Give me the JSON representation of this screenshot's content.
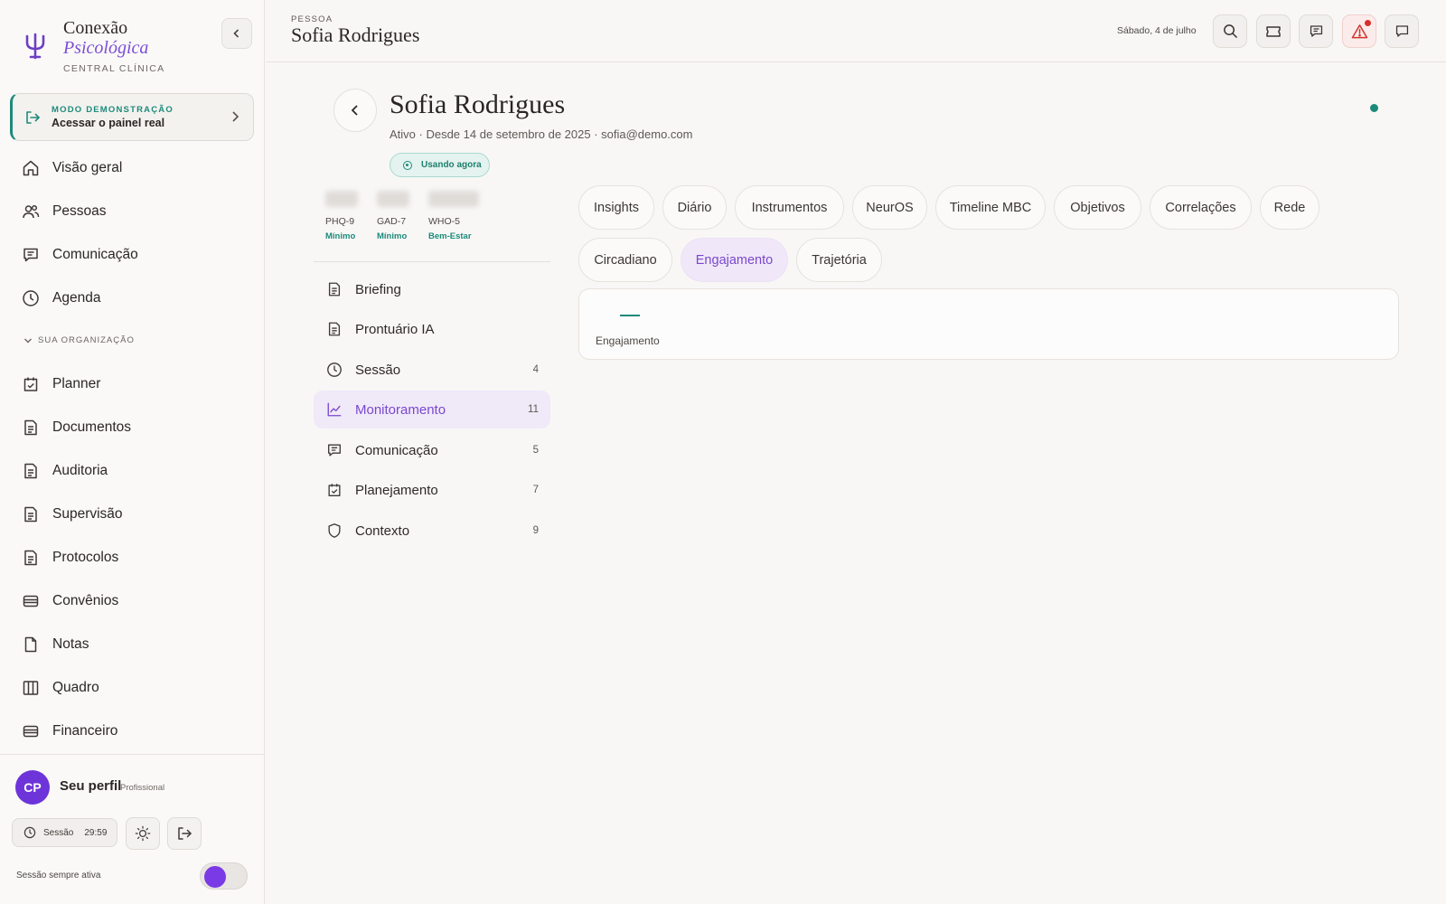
{
  "brand": {
    "line1": "Conexão",
    "line2": "Psicológica",
    "sub": "CENTRAL CLÍNICA"
  },
  "demo": {
    "kicker": "MODO DEMONSTRAÇÃO",
    "title": "Acessar o painel real"
  },
  "nav_main": [
    {
      "label": "Visão geral",
      "icon": "home-icon"
    },
    {
      "label": "Pessoas",
      "icon": "people-icon"
    },
    {
      "label": "Comunicação",
      "icon": "chat-icon"
    },
    {
      "label": "Agenda",
      "icon": "clock-icon"
    }
  ],
  "org_label": "SUA ORGANIZAÇÃO",
  "nav_org": [
    {
      "label": "Planner",
      "icon": "calendar-check-icon"
    },
    {
      "label": "Documentos",
      "icon": "document-icon"
    },
    {
      "label": "Auditoria",
      "icon": "document-icon"
    },
    {
      "label": "Supervisão",
      "icon": "document-icon"
    },
    {
      "label": "Protocolos",
      "icon": "document-icon"
    },
    {
      "label": "Convênios",
      "icon": "card-icon"
    },
    {
      "label": "Notas",
      "icon": "file-icon"
    },
    {
      "label": "Quadro",
      "icon": "board-icon"
    },
    {
      "label": "Financeiro",
      "icon": "card-icon"
    }
  ],
  "profile": {
    "initials": "CP",
    "name": "Seu perfil",
    "role": "Profissional"
  },
  "session": {
    "label": "Sessão",
    "timer": "29:59",
    "always_label": "Sessão sempre ativa",
    "always_on": true
  },
  "header": {
    "kicker": "PESSOA",
    "title": "Sofia Rodrigues",
    "date": "Sábado, 4 de julho"
  },
  "person": {
    "name": "Sofia Rodrigues",
    "meta": "Ativo · Desde 14 de setembro de 2025 · sofia@demo.com",
    "badge": "Usando agora"
  },
  "scores": [
    {
      "label": "PHQ-9",
      "level": "Mínimo"
    },
    {
      "label": "GAD-7",
      "level": "Mínimo"
    },
    {
      "label": "WHO-5",
      "level": "Bem-Estar"
    }
  ],
  "sections": [
    {
      "label": "Briefing",
      "count": "",
      "icon": "document-icon"
    },
    {
      "label": "Prontuário IA",
      "count": "",
      "icon": "document-icon"
    },
    {
      "label": "Sessão",
      "count": "4",
      "icon": "clock-icon"
    },
    {
      "label": "Monitoramento",
      "count": "11",
      "icon": "chart-icon",
      "active": true
    },
    {
      "label": "Comunicação",
      "count": "5",
      "icon": "chat-icon"
    },
    {
      "label": "Planejamento",
      "count": "7",
      "icon": "calendar-check-icon"
    },
    {
      "label": "Contexto",
      "count": "9",
      "icon": "shield-icon"
    }
  ],
  "tabs": [
    {
      "label": "Insights"
    },
    {
      "label": "Diário"
    },
    {
      "label": "Instrumentos"
    },
    {
      "label": "NeurOS"
    },
    {
      "label": "Timeline MBC"
    },
    {
      "label": "Objetivos"
    },
    {
      "label": "Correlações"
    },
    {
      "label": "Rede"
    },
    {
      "label": "Circadiano"
    },
    {
      "label": "Engajamento",
      "active": true
    },
    {
      "label": "Trajetória"
    }
  ],
  "engagement": {
    "label": "Engajamento"
  },
  "colors": {
    "accent": "#7a47cf",
    "teal": "#1c8a7a",
    "alert": "#d7302b"
  }
}
